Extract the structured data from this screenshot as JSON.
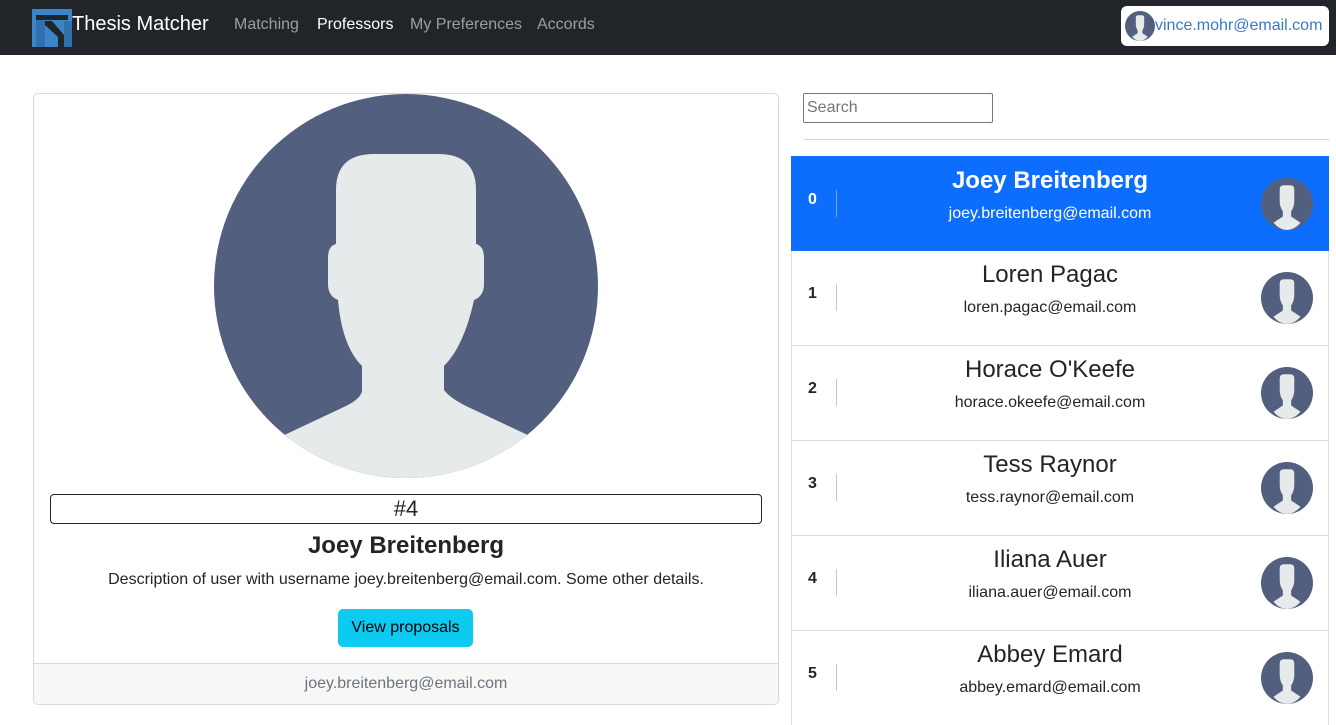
{
  "navbar": {
    "brand": "Thesis Matcher",
    "links": [
      "Matching",
      "Professors",
      "My Preferences",
      "Accords"
    ],
    "active_link": "Professors",
    "user_email": "vince.mohr@email.com"
  },
  "colors": {
    "navbar_bg": "#212529",
    "primary": "#0d6efd",
    "info_button": "#0dcaf0",
    "avatar_bg": "#535f7f",
    "avatar_fg": "#e6eaeb",
    "logo_blue": "#3a86c8"
  },
  "professor_card": {
    "rank": "#4",
    "name": "Joey Breitenberg",
    "description": "Description of user with username joey.breitenberg@email.com. Some other details.",
    "button_label": "View proposals",
    "footer_email": "joey.breitenberg@email.com"
  },
  "search": {
    "placeholder": "Search",
    "value": ""
  },
  "professors": [
    {
      "index": "0",
      "name": "Joey Breitenberg",
      "email": "joey.breitenberg@email.com",
      "active": true
    },
    {
      "index": "1",
      "name": "Loren Pagac",
      "email": "loren.pagac@email.com",
      "active": false
    },
    {
      "index": "2",
      "name": "Horace O'Keefe",
      "email": "horace.okeefe@email.com",
      "active": false
    },
    {
      "index": "3",
      "name": "Tess Raynor",
      "email": "tess.raynor@email.com",
      "active": false
    },
    {
      "index": "4",
      "name": "Iliana Auer",
      "email": "iliana.auer@email.com",
      "active": false
    },
    {
      "index": "5",
      "name": "Abbey Emard",
      "email": "abbey.emard@email.com",
      "active": false
    }
  ]
}
